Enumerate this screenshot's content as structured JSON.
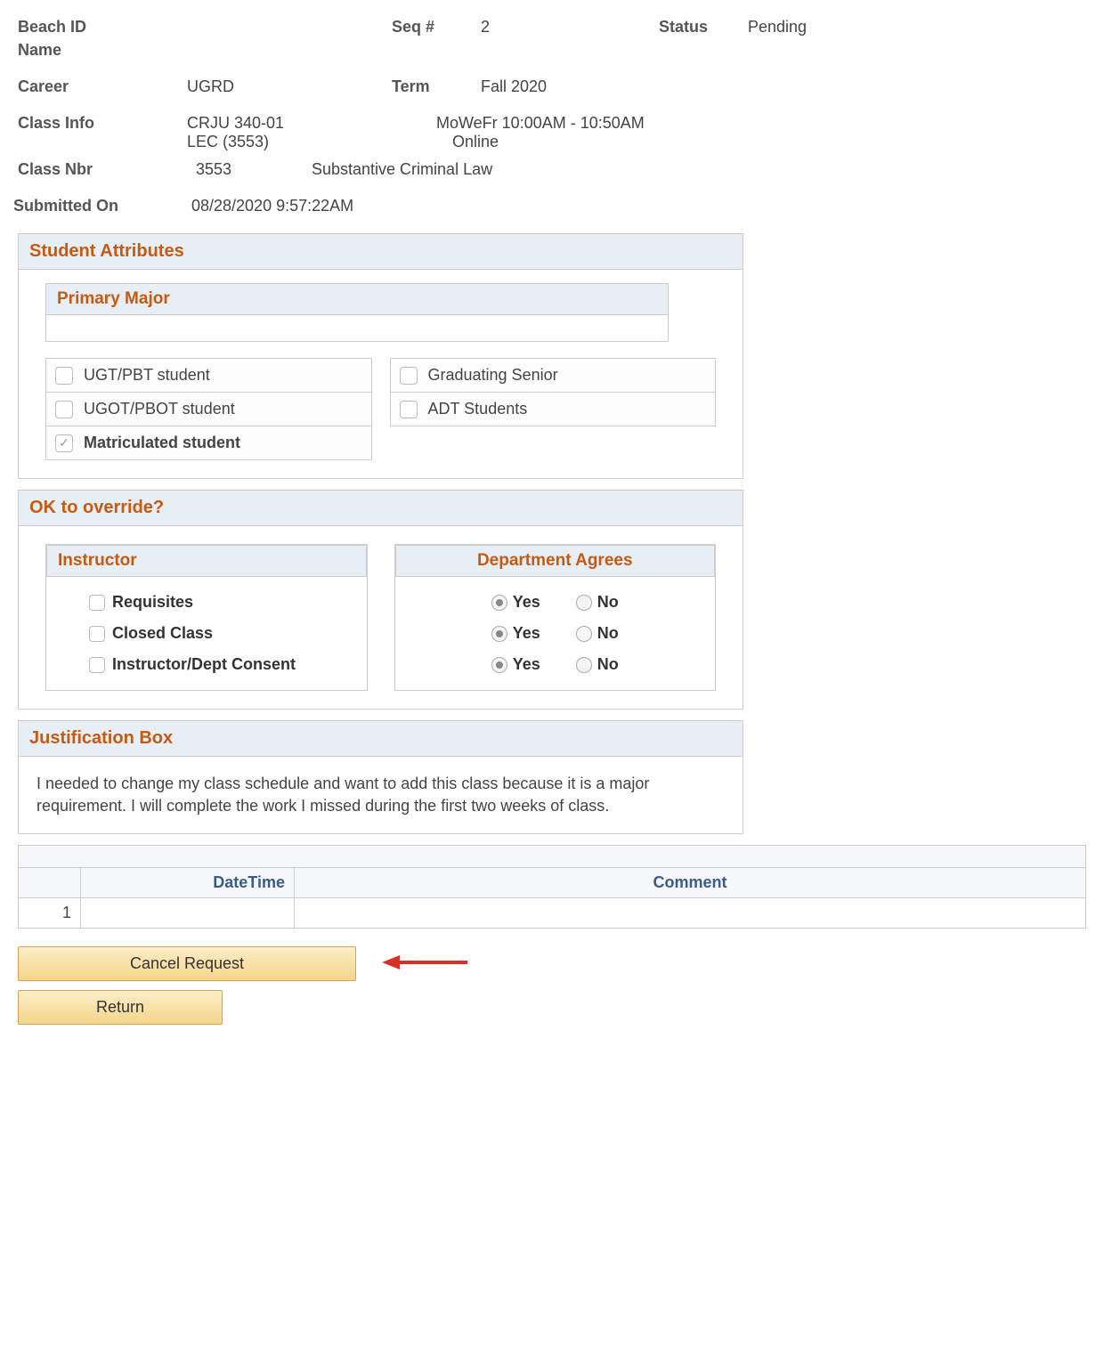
{
  "header": {
    "beach_id_label": "Beach ID",
    "beach_id_value": "",
    "seq_label": "Seq #",
    "seq_value": "2",
    "status_label": "Status",
    "status_value": "Pending",
    "name_label": "Name",
    "name_value": "",
    "career_label": "Career",
    "career_value": "UGRD",
    "term_label": "Term",
    "term_value": "Fall 2020",
    "class_info_label": "Class Info",
    "class_info_value1": "CRJU 340-01",
    "class_info_value2": "LEC (3553)",
    "class_info_sched": "MoWeFr 10:00AM - 10:50AM",
    "class_info_loc": "Online",
    "class_nbr_label": "Class Nbr",
    "class_nbr_value": "3553",
    "class_title": "Substantive Criminal Law",
    "submitted_label": "Submitted On",
    "submitted_value": "08/28/2020  9:57:22AM"
  },
  "student_attributes": {
    "title": "Student Attributes",
    "primary_major_label": "Primary Major",
    "primary_major_value": "",
    "items": [
      {
        "label": "UGT/PBT student",
        "checked": false,
        "bold": false
      },
      {
        "label": "UGOT/PBOT student",
        "checked": false,
        "bold": false
      },
      {
        "label": "Matriculated student",
        "checked": true,
        "bold": true
      },
      {
        "label": "Graduating Senior",
        "checked": false,
        "bold": false
      },
      {
        "label": "ADT Students",
        "checked": false,
        "bold": false
      }
    ]
  },
  "override": {
    "title": "OK to override?",
    "instructor_label": "Instructor",
    "dept_label": "Department Agrees",
    "items": [
      {
        "label": "Requisites"
      },
      {
        "label": "Closed Class"
      },
      {
        "label": "Instructor/Dept Consent"
      }
    ],
    "yes": "Yes",
    "no": "No",
    "dept_rows": [
      {
        "selected": "yes"
      },
      {
        "selected": "yes"
      },
      {
        "selected": "yes"
      }
    ]
  },
  "justification": {
    "title": "Justification Box",
    "text": "I needed to change my class schedule and want to add this class because it is a major requirement. I will complete the work I missed during the first two weeks of class."
  },
  "comments": {
    "headers": {
      "datetime": "DateTime",
      "comment": "Comment"
    },
    "rows": [
      {
        "num": "1",
        "datetime": "",
        "comment": ""
      }
    ]
  },
  "buttons": {
    "cancel": "Cancel Request",
    "return": "Return"
  }
}
